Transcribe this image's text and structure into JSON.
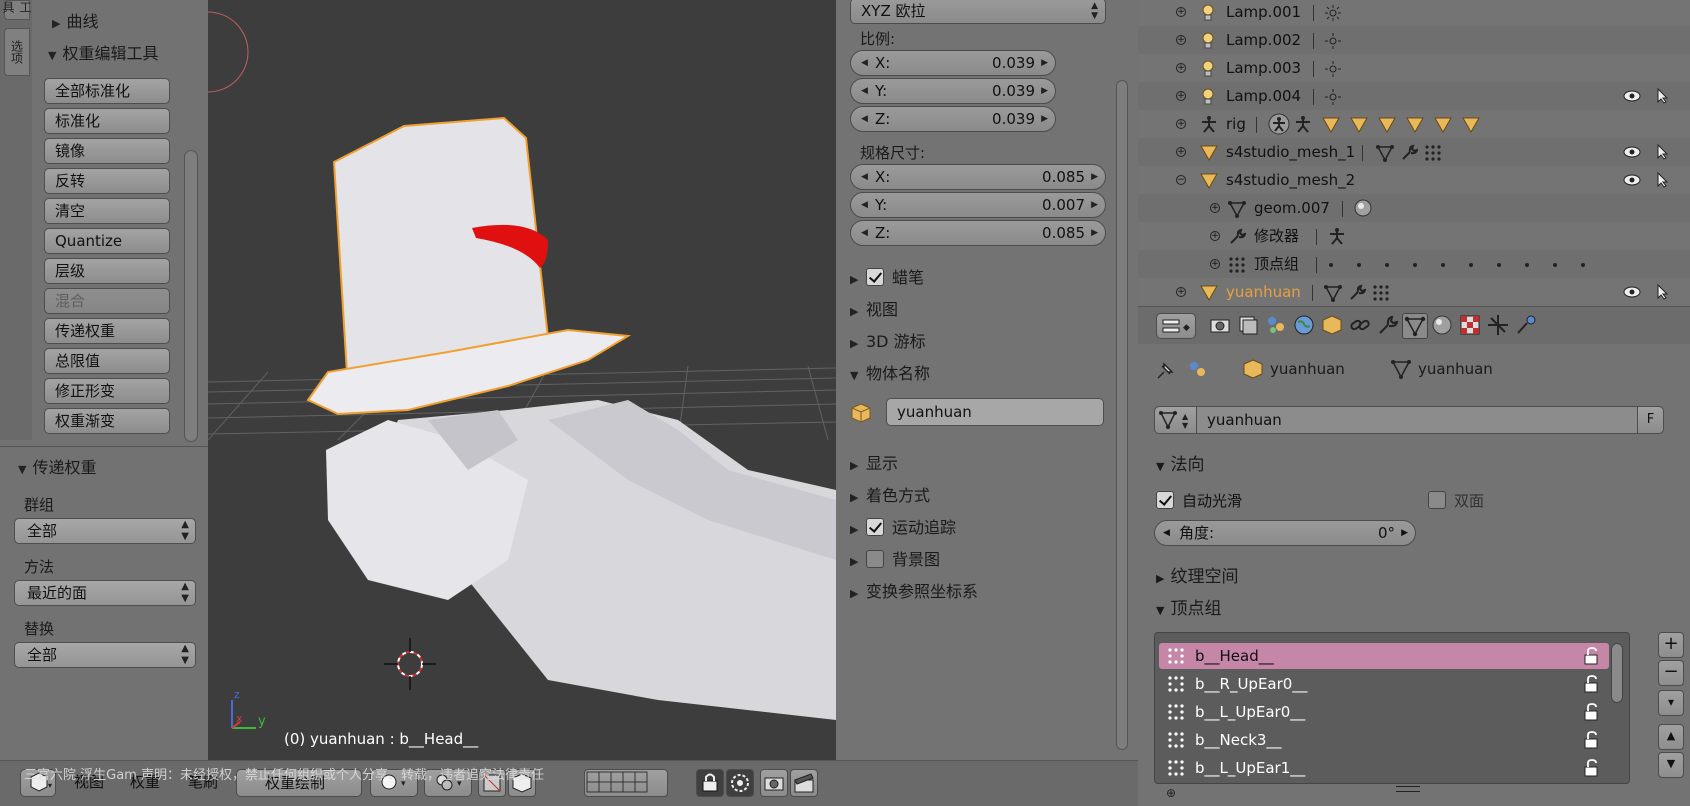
{
  "toolshelf": {
    "tabs": [
      "工具",
      "选项"
    ],
    "curve_label": "曲线",
    "weight_tools_label": "权重编辑工具",
    "buttons": [
      "全部标准化",
      "标准化",
      "镜像",
      "反转",
      "清空",
      "Quantize",
      "层级",
      "混合",
      "传递权重",
      "总限值",
      "修正形变",
      "权重渐变"
    ],
    "transfer_panel": {
      "title": "传递权重",
      "group_label": "群组",
      "group_value": "全部",
      "method_label": "方法",
      "method_value": "最近的面",
      "replace_label": "替换",
      "replace_value": "全部"
    }
  },
  "viewport": {
    "info": "(0) yuanhuan : b__Head__",
    "axis_x": "x",
    "axis_y": "y",
    "axis_z": "z"
  },
  "npanel": {
    "rotation_mode": "XYZ 欧拉",
    "scale_label": "比例:",
    "scale": [
      {
        "axis": "X:",
        "value": "0.039"
      },
      {
        "axis": "Y:",
        "value": "0.039"
      },
      {
        "axis": "Z:",
        "value": "0.039"
      }
    ],
    "dimensions_label": "规格尺寸:",
    "dimensions": [
      {
        "axis": "X:",
        "value": "0.085"
      },
      {
        "axis": "Y:",
        "value": "0.007"
      },
      {
        "axis": "Z:",
        "value": "0.085"
      }
    ],
    "sections": {
      "grease_pencil": "蜡笔",
      "view": "视图",
      "cursor_3d": "3D 游标",
      "item_name": "物体名称",
      "object_name_value": "yuanhuan",
      "display": "显示",
      "shading": "着色方式",
      "motion_tracking": "运动追踪",
      "background_images": "背景图",
      "transform_orientations": "变换参照坐标系"
    }
  },
  "outliner": {
    "rows": [
      {
        "name": "Lamp.001"
      },
      {
        "name": "Lamp.002"
      },
      {
        "name": "Lamp.003"
      },
      {
        "name": "Lamp.004"
      },
      {
        "name": "rig"
      },
      {
        "name": "s4studio_mesh_1"
      },
      {
        "name": "s4studio_mesh_2"
      },
      {
        "name": "geom.007"
      },
      {
        "name": "修改器"
      },
      {
        "name": "顶点组"
      },
      {
        "name": "yuanhuan"
      }
    ]
  },
  "properties": {
    "object_name": "yuanhuan",
    "mesh_name": "yuanhuan",
    "datablock_value": "yuanhuan",
    "fake_user": "F",
    "normals_title": "法向",
    "auto_smooth": "自动光滑",
    "double_sided": "双面",
    "angle_label": "角度:",
    "angle_value": "0°",
    "texture_space": "纹理空间",
    "vertex_groups_title": "顶点组",
    "vertex_groups": [
      "b__Head__",
      "b__R_UpEar0__",
      "b__L_UpEar0__",
      "b__Neck3__",
      "b__L_UpEar1__"
    ],
    "add": "+",
    "remove": "−",
    "menu": "▾",
    "up": "▲",
    "down": "▼"
  },
  "header": {
    "view": "视图",
    "weights": "权重",
    "brush": "笔刷",
    "mode": "权重绘制"
  },
  "status_overlay": "三官六院 浮生Gam 声明：未经授权，禁止任何组织或个人分享、转载，违者追究法律责任",
  "colors": {
    "selected_text": "#e8a040",
    "active_vertex_group": "#c586a8",
    "hat_red": "#e01010",
    "select_outline": "#f0a030"
  }
}
